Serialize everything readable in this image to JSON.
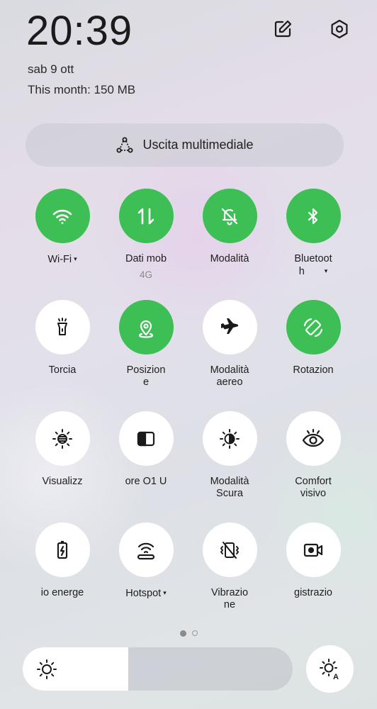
{
  "status": {
    "time": "20:39",
    "date": "sab 9 ott",
    "data_usage": "This month: 150 MB"
  },
  "header_icons": {
    "edit": "edit-icon",
    "settings": "settings-icon"
  },
  "media": {
    "label": "Uscita multimediale"
  },
  "tiles": [
    {
      "label": "Wi-Fi",
      "state": "on",
      "caret": true
    },
    {
      "label": "Dati mob",
      "sub": "4G",
      "state": "on"
    },
    {
      "label": "Modalità",
      "state": "on"
    },
    {
      "label": "Bluetoot",
      "label2": "h",
      "state": "on",
      "caret": true
    },
    {
      "label": "Torcia",
      "state": "off"
    },
    {
      "label": "Posizion",
      "label2": "e",
      "state": "on"
    },
    {
      "label": "Modalità",
      "label2": "aereo",
      "state": "off"
    },
    {
      "label": "Rotazion",
      "state": "on"
    },
    {
      "label": "Visualizz",
      "state": "off"
    },
    {
      "label": "ore O1 U",
      "state": "off"
    },
    {
      "label": "Modalità",
      "label2": "Scura",
      "state": "off"
    },
    {
      "label": "Comfort",
      "label2": "visivo",
      "state": "off"
    },
    {
      "label": "io energe",
      "state": "off"
    },
    {
      "label": "Hotspot",
      "state": "off",
      "caret": true
    },
    {
      "label": "Vibrazio",
      "label2": "ne",
      "state": "off"
    },
    {
      "label": "gistrazio",
      "state": "off"
    }
  ],
  "caret_glyph": "▾",
  "pagination": {
    "pages": 2,
    "current": 1
  },
  "brightness": {
    "level": 0.39
  },
  "colors": {
    "accent_on": "#3dbf55",
    "tile_off": "#ffffff"
  }
}
